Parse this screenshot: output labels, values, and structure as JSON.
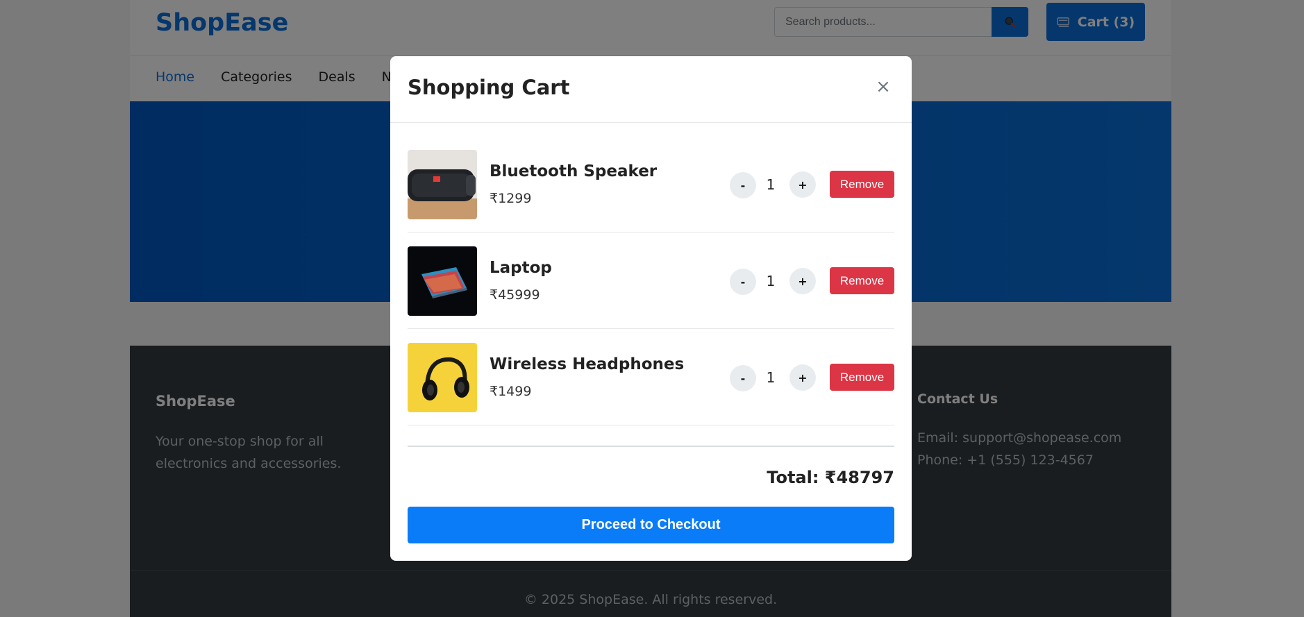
{
  "header": {
    "logo": "ShopEase",
    "search_placeholder": "Search products...",
    "cart_label": "Cart (3)"
  },
  "nav": {
    "items": [
      "Home",
      "Categories",
      "Deals",
      "Ne"
    ]
  },
  "footer": {
    "brand": "ShopEase",
    "description": "Your one-stop shop for all electronics and accessories.",
    "contact_title": "Contact Us",
    "email": "Email: support@shopease.com",
    "phone": "Phone: +1 (555) 123-4567",
    "copyright": "© 2025 ShopEase. All rights reserved."
  },
  "modal": {
    "title": "Shopping Cart",
    "close": "×",
    "items": [
      {
        "name": "Bluetooth Speaker",
        "price": "₹1299",
        "qty": "1",
        "minus": "-",
        "plus": "+",
        "remove": "Remove"
      },
      {
        "name": "Laptop",
        "price": "₹45999",
        "qty": "1",
        "minus": "-",
        "plus": "+",
        "remove": "Remove"
      },
      {
        "name": "Wireless Headphones",
        "price": "₹1499",
        "qty": "1",
        "minus": "-",
        "plus": "+",
        "remove": "Remove"
      }
    ],
    "total": "Total: ₹48797",
    "checkout": "Proceed to Checkout"
  },
  "colors": {
    "primary": "#0a6fd8",
    "danger": "#dc3545",
    "checkout": "#0b7cf7",
    "footer_bg": "#343a40"
  },
  "icons": {
    "search": "search-icon",
    "cart": "cart-icon",
    "close": "close-icon"
  }
}
